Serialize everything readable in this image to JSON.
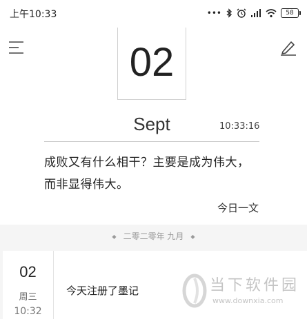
{
  "status_bar": {
    "time": "上午10:33",
    "battery": "58"
  },
  "today": {
    "day": "02",
    "month": "Sept",
    "clock": "10:33:16"
  },
  "daily_quote": {
    "text": "成败又有什么相干？主要是成为伟大，而非显得伟大。",
    "source": "今日一文"
  },
  "journal": {
    "group_header": "二零二零年 九月",
    "entries": [
      {
        "day": "02",
        "weekday": "周三",
        "time": "10:32",
        "text": "今天注册了墨记"
      }
    ]
  },
  "watermark": {
    "title": "当下软件园",
    "url": "www.downxia.com"
  },
  "colors": {
    "background": "#f5f5f5",
    "card": "#ffffff",
    "text": "#222222",
    "muted": "#9a9a9a"
  }
}
